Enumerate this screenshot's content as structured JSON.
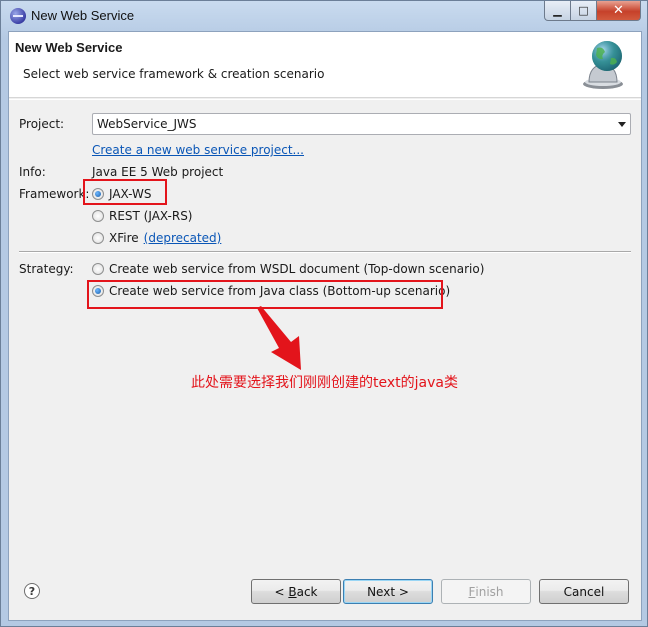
{
  "window": {
    "title": "New Web Service",
    "controls": {
      "minimize": "▁",
      "maximize": "□",
      "close": "✕"
    }
  },
  "banner": {
    "title": "New Web Service",
    "description": "Select web service framework & creation scenario",
    "icon": "web-service-globe-icon"
  },
  "form": {
    "project_label": "Project:",
    "project_value": "WebService_JWS",
    "create_project_link": "Create a new web service project...",
    "info_label": "Info:",
    "info_value": "Java EE 5 Web project",
    "framework_label": "Framework:",
    "framework_options": [
      {
        "label": "JAX-WS",
        "selected": true
      },
      {
        "label": "REST (JAX-RS)",
        "selected": false
      },
      {
        "label": "XFire",
        "selected": false,
        "link": "(deprecated)"
      }
    ],
    "strategy_label": "Strategy:",
    "strategy_options": [
      {
        "label": "Create web service from WSDL document (Top-down scenario)",
        "selected": false
      },
      {
        "label": "Create web service from Java class (Bottom-up scenario)",
        "selected": true
      }
    ]
  },
  "annotation": {
    "text": "此处需要选择我们刚刚创建的text的java类",
    "color": "#e3141b"
  },
  "buttons": {
    "help": "?",
    "back_prefix": "< ",
    "back_mnemonic": "B",
    "back_rest": "ack",
    "next": "Next >",
    "finish_mnemonic": "F",
    "finish_rest": "inish",
    "cancel": "Cancel"
  }
}
